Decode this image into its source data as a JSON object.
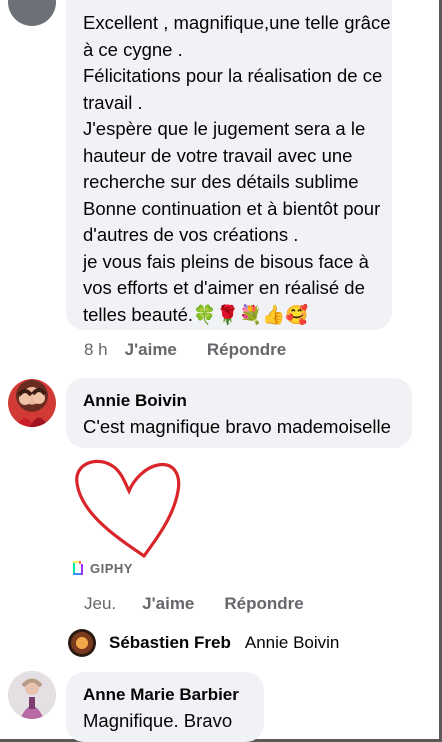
{
  "comments": [
    {
      "text": "Excellent , magnifique,une telle grâce\nà ce cygne  .\nFélicitations pour la réalisation de ce\ntravail .\nJ'espère que le jugement sera a le\nhauteur de votre travail avec une\nrecherche sur des détails sublime\nBonne continuation et à bientôt pour\nd'autres de vos créations .\nje vous fais pleins de bisous face à\nvos efforts et d'aimer en réalisé de\ntelles beauté.🍀🌹💐👍🥰",
      "time": "8 h",
      "like_label": "J'aime",
      "reply_label": "Répondre"
    },
    {
      "author": "Annie Boivin",
      "text": "C'est magnifique bravo mademoiselle",
      "gif_label": "GIPHY",
      "time": "Jeu.",
      "like_label": "J'aime",
      "reply_label": "Répondre",
      "reply": {
        "author": "Sébastien Freb",
        "text": "Annie Boivin"
      }
    },
    {
      "author": "Anne Marie Barbier",
      "text": "Magnifique.  Bravo"
    }
  ],
  "colors": {
    "bubble": "#f0f2f5",
    "secondary_text": "#65676b",
    "heart": "#d9252a",
    "giphy_green": "#00e6a1",
    "giphy_blue": "#3b8cff"
  }
}
